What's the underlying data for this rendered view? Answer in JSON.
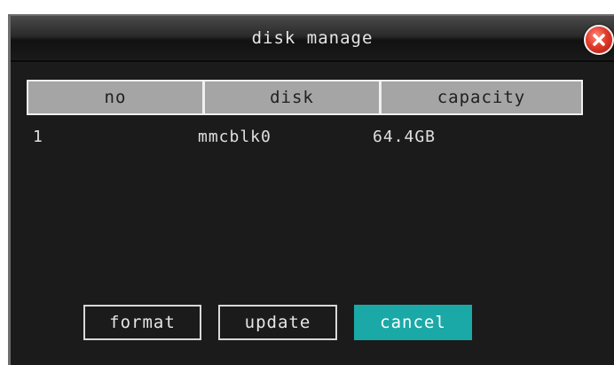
{
  "dialog": {
    "title": "disk manage",
    "close_icon": "close-icon"
  },
  "table": {
    "columns": [
      "no",
      "disk",
      "capacity"
    ],
    "rows": [
      {
        "no": "1",
        "disk": "mmcblk0",
        "capacity": "64.4GB"
      }
    ]
  },
  "buttons": {
    "format": "format",
    "update": "update",
    "cancel": "cancel"
  },
  "colors": {
    "dialog_bg": "#1b1b1b",
    "header_bg": "#a5a5a5",
    "accent": "#1aa9a7",
    "close_red": "#e23a2a"
  }
}
